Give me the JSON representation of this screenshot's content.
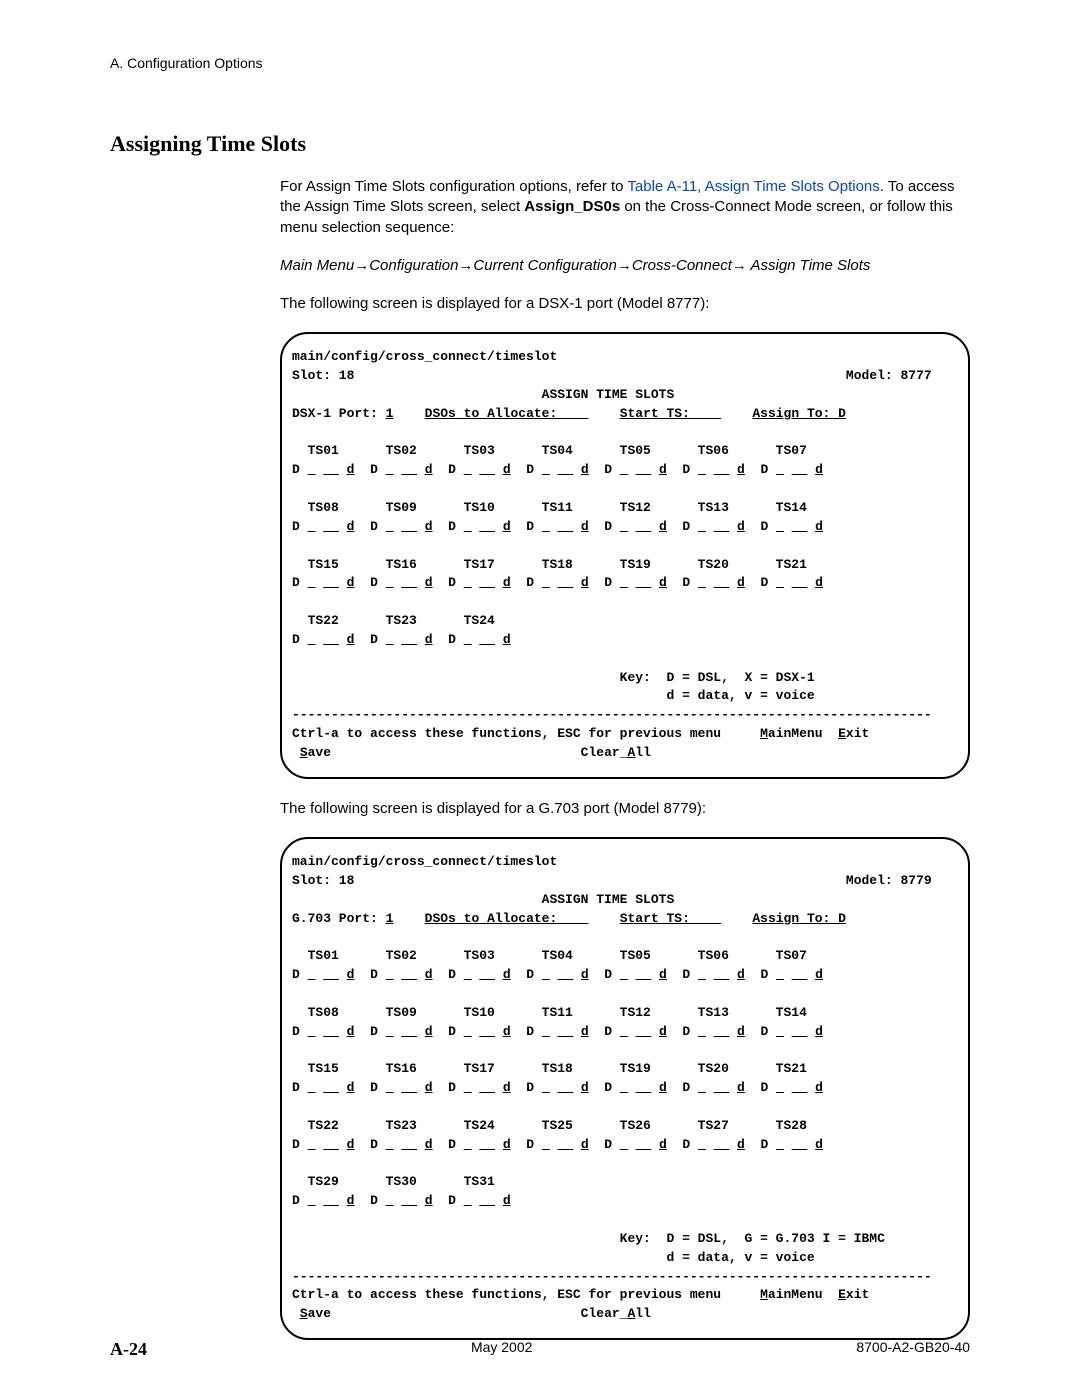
{
  "header": {
    "section_label": "A. Configuration Options"
  },
  "heading": "Assigning Time Slots",
  "intro": {
    "part1": "For Assign Time Slots configuration options, refer to ",
    "link_text": "Table A-11, Assign Time Slots Options",
    "part2": ". To access the Assign Time Slots screen, select ",
    "bold_cmd": "Assign_DS0s",
    "part3": " on the Cross-Connect Mode screen, or follow this menu selection sequence:"
  },
  "menu_seq": "Main Menu→Configuration→Current Configuration→Cross-Connect→ Assign Time Slots",
  "screen1_caption": "The following screen is displayed for a DSX-1 port (Model 8777):",
  "screen2_caption": "The following screen is displayed for a G.703 port (Model 8779):",
  "terminal1": {
    "path": "main/config/cross_connect/timeslot",
    "slot_line_left": "Slot: 18",
    "slot_line_right": "Model: 8777",
    "title": "ASSIGN TIME SLOTS",
    "port_line": {
      "port_label": "DSX-1 Port:",
      "port_value": "1",
      "dsos_label": "DSOs to Allocate:",
      "dsos_value": "",
      "start_label": "Start TS:",
      "start_value": "",
      "assign_label": "Assign To:",
      "assign_value": "D"
    },
    "rows": [
      {
        "slots": [
          "TS01",
          "TS02",
          "TS03",
          "TS04",
          "TS05",
          "TS06",
          "TS07"
        ]
      },
      {
        "slots": [
          "TS08",
          "TS09",
          "TS10",
          "TS11",
          "TS12",
          "TS13",
          "TS14"
        ]
      },
      {
        "slots": [
          "TS15",
          "TS16",
          "TS17",
          "TS18",
          "TS19",
          "TS20",
          "TS21"
        ]
      },
      {
        "slots": [
          "TS22",
          "TS23",
          "TS24"
        ]
      }
    ],
    "cell_pattern": "D _ __ d",
    "key_line1": "Key:  D = DSL,  X = DSX-1",
    "key_line2": "d = data, v = voice",
    "help_line": "Ctrl-a to access these functions, ESC for previous menu",
    "menu_items": [
      "MainMenu",
      "Exit",
      "Save",
      "Clear_All"
    ]
  },
  "terminal2": {
    "path": "main/config/cross_connect/timeslot",
    "slot_line_left": "Slot: 18",
    "slot_line_right": "Model: 8779",
    "title": "ASSIGN TIME SLOTS",
    "port_line": {
      "port_label": "G.703 Port:",
      "port_value": "1",
      "dsos_label": "DSOs to Allocate:",
      "dsos_value": "",
      "start_label": "Start TS:",
      "start_value": "",
      "assign_label": "Assign To:",
      "assign_value": "D"
    },
    "rows": [
      {
        "slots": [
          "TS01",
          "TS02",
          "TS03",
          "TS04",
          "TS05",
          "TS06",
          "TS07"
        ]
      },
      {
        "slots": [
          "TS08",
          "TS09",
          "TS10",
          "TS11",
          "TS12",
          "TS13",
          "TS14"
        ]
      },
      {
        "slots": [
          "TS15",
          "TS16",
          "TS17",
          "TS18",
          "TS19",
          "TS20",
          "TS21"
        ]
      },
      {
        "slots": [
          "TS22",
          "TS23",
          "TS24",
          "TS25",
          "TS26",
          "TS27",
          "TS28"
        ]
      },
      {
        "slots": [
          "TS29",
          "TS30",
          "TS31"
        ]
      }
    ],
    "cell_pattern": "D _ __ d",
    "key_line1": "Key:  D = DSL,  G = G.703 I = IBMC",
    "key_line2": "d = data, v = voice",
    "help_line": "Ctrl-a to access these functions, ESC for previous menu",
    "menu_items": [
      "MainMenu",
      "Exit",
      "Save",
      "Clear_All"
    ]
  },
  "footer": {
    "page": "A-24",
    "date": "May 2002",
    "docid": "8700-A2-GB20-40"
  }
}
